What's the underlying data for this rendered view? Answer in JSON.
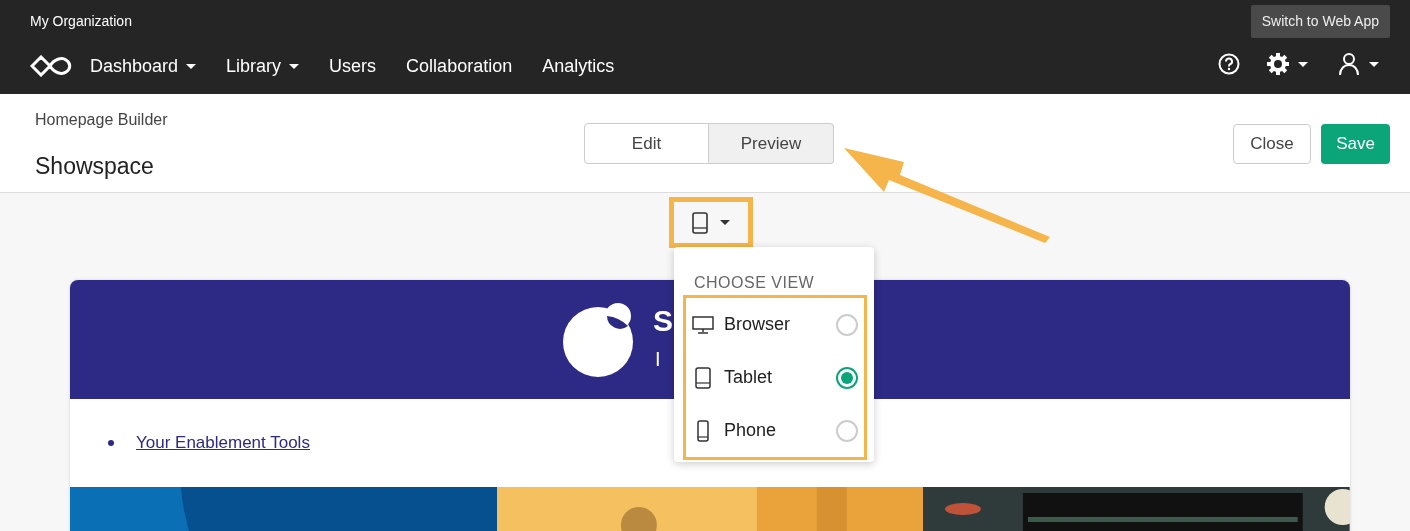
{
  "topbar": {
    "organization": "My Organization",
    "switch_button": "Switch to Web App"
  },
  "nav": [
    {
      "label": "Dashboard",
      "has_menu": true
    },
    {
      "label": "Library",
      "has_menu": true
    },
    {
      "label": "Users",
      "has_menu": false
    },
    {
      "label": "Collaboration",
      "has_menu": false
    },
    {
      "label": "Analytics",
      "has_menu": false
    }
  ],
  "header": {
    "breadcrumb": "Homepage Builder",
    "title": "Showspace",
    "modes": [
      {
        "label": "Edit",
        "selected": false
      },
      {
        "label": "Preview",
        "selected": true
      }
    ],
    "close_button": "Close",
    "save_button": "Save"
  },
  "view_menu": {
    "heading": "CHOOSE VIEW",
    "options": [
      {
        "kind": "browser",
        "label": "Browser",
        "selected": false
      },
      {
        "kind": "tablet",
        "label": "Tablet",
        "selected": true
      },
      {
        "kind": "phone",
        "label": "Phone",
        "selected": false
      }
    ]
  },
  "banner": {
    "title": "S",
    "subtitle": "I",
    "links": [
      "Your Enablement Tools"
    ],
    "tiles": [
      {
        "kind": "picture"
      },
      {
        "kind": "picture"
      },
      {
        "kind": "picture"
      }
    ]
  }
}
